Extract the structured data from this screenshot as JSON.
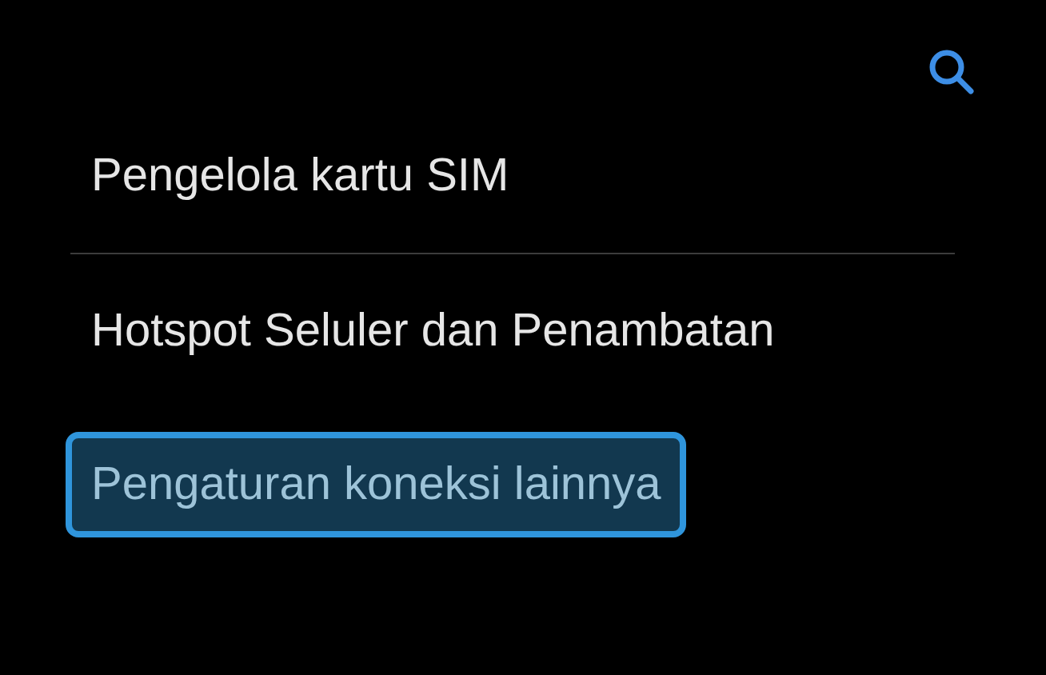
{
  "sections": [
    {
      "items": [
        {
          "label": "Pengelola kartu SIM",
          "selected": false
        }
      ]
    },
    {
      "items": [
        {
          "label": "Hotspot Seluler dan Penambatan",
          "selected": false
        },
        {
          "label": "Pengaturan koneksi lainnya",
          "selected": true
        }
      ]
    }
  ]
}
